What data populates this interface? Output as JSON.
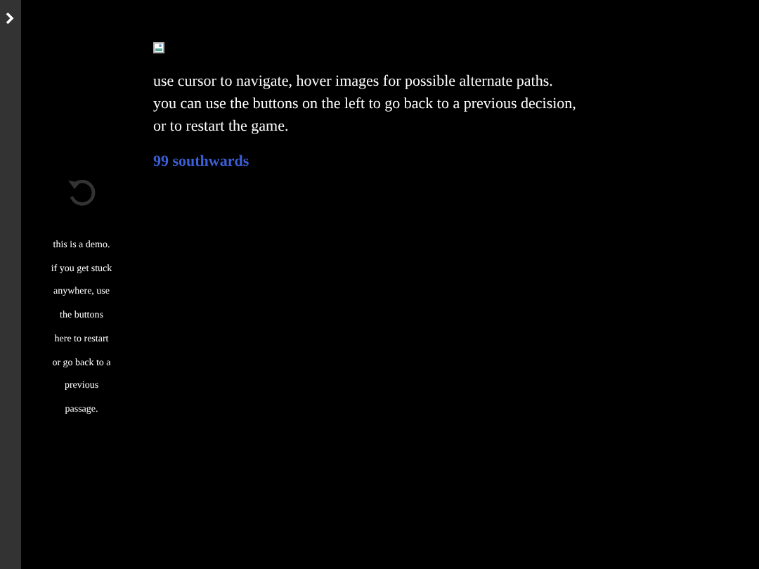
{
  "sidebar": {
    "note": "this is a demo. if you get stuck anywhere, use the buttons here to restart or go back to a previous passage."
  },
  "passage": {
    "lines": [
      "use cursor to navigate, hover images for possible alternate paths.",
      "you can use the buttons on the left to go back to a previous decision, or to restart the game."
    ],
    "link": "99 southwards"
  }
}
